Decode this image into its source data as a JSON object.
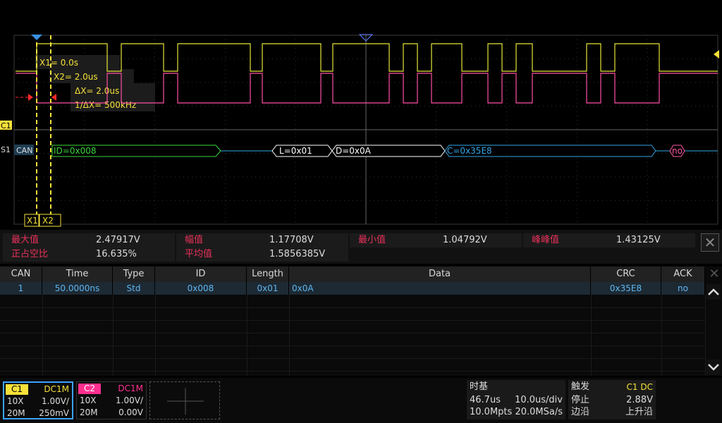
{
  "scope": {
    "c1_marker": "C1",
    "s1_marker": "S1",
    "can_badge": "CAN",
    "cursor_readouts": {
      "x1": "X1= 0.0s",
      "x2": "X2= 2.0us",
      "dx": "ΔX= 2.0us",
      "inv_dx": "1/ΔX= 500kHz"
    },
    "cursor_tags": {
      "x1": "X1",
      "x2": "X2"
    },
    "decode_segments": [
      {
        "label": "ID=0x008",
        "color": "#3bd63b"
      },
      {
        "label": "L=0x01",
        "color": "#ffffff"
      },
      {
        "label": "D=0x0A",
        "color": "#ffffff"
      },
      {
        "label": "C=0x35E8",
        "color": "#35a6e6"
      },
      {
        "label": "no",
        "color": "#ff5aa8"
      }
    ],
    "colors": {
      "c1": "#e5e53a",
      "c2": "#ff4fa6",
      "decode_line": "#35a6e6",
      "grid": "#3a3a3a",
      "cursor": "#f5e03a"
    }
  },
  "measurements": {
    "row1": [
      {
        "name": "最大值",
        "value": "2.47917V"
      },
      {
        "name": "幅值",
        "value": "1.17708V"
      },
      {
        "name": "最小值",
        "value": "1.04792V"
      },
      {
        "name": "峰峰值",
        "value": "1.43125V"
      }
    ],
    "row2": [
      {
        "name": "正占空比",
        "value": "16.635%"
      },
      {
        "name": "平均值",
        "value": "1.5856385V"
      }
    ],
    "close_glyph": "✕"
  },
  "decode_table": {
    "headers": [
      "CAN",
      "Time",
      "Type",
      "ID",
      "Length",
      "Data",
      "CRC",
      "ACK"
    ],
    "rows": [
      [
        "1",
        "50.0000ns",
        "Std",
        "0x008",
        "0x01",
        "0x0A",
        "0x35E8",
        "no"
      ]
    ],
    "close_glyph": "✕"
  },
  "channels": {
    "c1": {
      "tag": "C1",
      "coupling": "DC1M",
      "probe": "10X",
      "scale": "1.00V/",
      "bw": "20M",
      "offset": "250mV",
      "color": "#f5e03a"
    },
    "c2": {
      "tag": "C2",
      "coupling": "DC1M",
      "probe": "10X",
      "scale": "1.00V/",
      "bw": "20M",
      "offset": "0.00V",
      "color": "#ff2f8f"
    }
  },
  "timebase": {
    "title": "时基",
    "delay": "46.7us",
    "div": "10.0us/div",
    "points": "10.0Mpts",
    "rate": "20.0MSa/s"
  },
  "trigger": {
    "title": "触发",
    "source": "C1 DC",
    "state": "停止",
    "level": "2.88V",
    "edge_label": "边沿",
    "slope": "上升沿"
  }
}
